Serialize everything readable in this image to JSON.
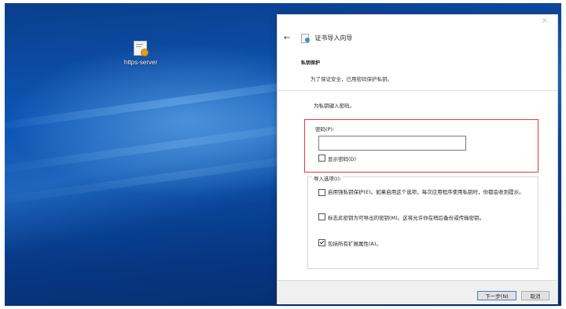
{
  "desktop": {
    "icon_label": "https-server",
    "icon_name": "certificate-file-icon"
  },
  "dialog": {
    "close_glyph": "×",
    "back_glyph": "←",
    "title": "证书导入向导",
    "section_title": "私钥保护",
    "section_subtitle": "为了保证安全，已用密码保护私钥。",
    "prompt": "为私钥键入密码。",
    "password_label": "密码(P):",
    "password_value": "",
    "show_password_label": "显示密码(D)",
    "import_options_label": "导入选项(I):",
    "options": [
      {
        "label": "启用强私钥保护(E)。如果启用这个选项，每次应用程序使用私钥时，你都会收到提示。",
        "checked": false
      },
      {
        "label": "标志此密钥为可导出的密钥(M)。这将允许你在稍后备份或传输密钥。",
        "checked": false
      },
      {
        "label": "包括所有扩展属性(A)。",
        "checked": true
      }
    ],
    "buttons": {
      "next": "下一步(N)",
      "cancel": "取消"
    }
  },
  "colors": {
    "highlight": "#e23b3b",
    "desktop_blue": "#0d56b6",
    "primary_button_border": "#3c7fcf"
  }
}
